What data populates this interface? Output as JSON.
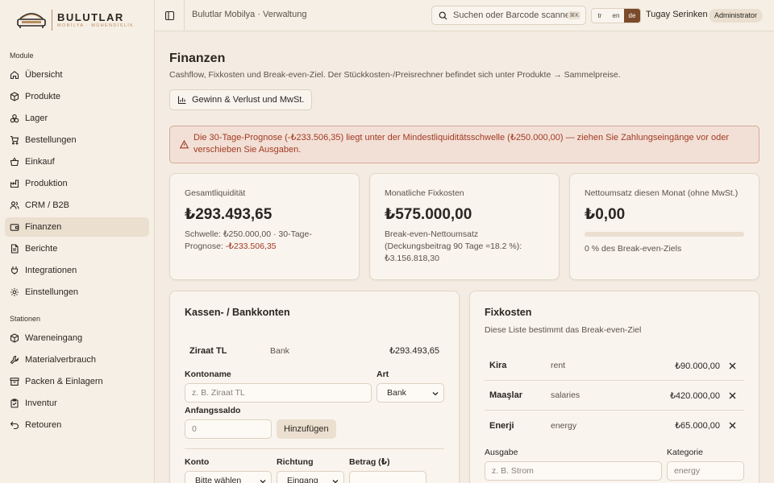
{
  "brand": {
    "name": "BULUTLAR",
    "tagline": "MOBİLYA · MÜHENDİSLİK"
  },
  "sidebar": {
    "modules_label": "Module",
    "modules": [
      {
        "label": "Übersicht",
        "icon": "home-icon",
        "active": false
      },
      {
        "label": "Produkte",
        "icon": "box-icon",
        "active": false
      },
      {
        "label": "Lager",
        "icon": "boxes-icon",
        "active": false
      },
      {
        "label": "Bestellungen",
        "icon": "cart-icon",
        "active": false
      },
      {
        "label": "Einkauf",
        "icon": "basket-icon",
        "active": false
      },
      {
        "label": "Produktion",
        "icon": "factory-icon",
        "active": false
      },
      {
        "label": "CRM / B2B",
        "icon": "users-icon",
        "active": false
      },
      {
        "label": "Finanzen",
        "icon": "wallet-icon",
        "active": true
      },
      {
        "label": "Berichte",
        "icon": "file-icon",
        "active": false
      },
      {
        "label": "Integrationen",
        "icon": "plug-icon",
        "active": false
      },
      {
        "label": "Einstellungen",
        "icon": "gear-icon",
        "active": false
      }
    ],
    "stations_label": "Stationen",
    "stations": [
      {
        "label": "Wareneingang",
        "icon": "package-in-icon"
      },
      {
        "label": "Materialverbrauch",
        "icon": "wrench-icon"
      },
      {
        "label": "Packen & Einlagern",
        "icon": "archive-icon"
      },
      {
        "label": "Inventur",
        "icon": "clipboard-icon"
      },
      {
        "label": "Retouren",
        "icon": "return-icon"
      }
    ]
  },
  "topbar": {
    "breadcrumb": "Bulutlar Mobilya · Verwaltung",
    "search_placeholder": "Suchen oder Barcode scannen",
    "search_shortcut": "⌘K",
    "languages": [
      "tr",
      "en",
      "de"
    ],
    "active_language": "de",
    "user_name": "Tugay Serinken",
    "user_role": "Administrator"
  },
  "page": {
    "title": "Finanzen",
    "subtitle": "Cashflow, Fixkosten und Break-even-Ziel. Der Stückkosten-/Preisrechner befindet sich unter Produkte → Sammelpreise.",
    "pl_button": "Gewinn & Verlust und MwSt.",
    "alert": "Die 30-Tage-Prognose (-₺233.506,35) liegt unter der Mindestliquiditätsschwelle (₺250.000,00) — ziehen Sie Zahlungseingänge vor oder verschieben Sie Ausgaben."
  },
  "stats": {
    "liquidity": {
      "label": "Gesamtliquidität",
      "value": "₺293.493,65",
      "note_prefix": "Schwelle: ₺250.000,00 · 30-Tage-Prognose: ",
      "note_negative": "-₺233.506,35"
    },
    "fixed": {
      "label": "Monatliche Fixkosten",
      "value": "₺575.000,00",
      "note": "Break-even-Nettoumsatz (Deckungsbeitrag 90 Tage ≈18.2 %): ₺3.156.818,30"
    },
    "revenue": {
      "label": "Nettoumsatz diesen Monat (ohne MwSt.)",
      "value": "₺0,00",
      "progress_percent": 0,
      "note": "0 % des Break-even-Ziels"
    }
  },
  "accounts": {
    "title": "Kassen- / Bankkonten",
    "rows": [
      {
        "name": "Ziraat TL",
        "type": "Bank",
        "balance": "₺293.493,65"
      }
    ],
    "form": {
      "name_label": "Kontoname",
      "name_placeholder": "z. B. Ziraat TL",
      "type_label": "Art",
      "type_value": "Bank",
      "opening_label": "Anfangssaldo",
      "opening_placeholder": "0",
      "add_button": "Hinzufügen"
    },
    "tx_form": {
      "account_label": "Konto",
      "account_value": "Bitte wählen",
      "direction_label": "Richtung",
      "direction_value": "Eingang",
      "amount_label": "Betrag (₺)"
    }
  },
  "fixed_costs": {
    "title": "Fixkosten",
    "hint": "Diese Liste bestimmt das Break-even-Ziel",
    "rows": [
      {
        "name": "Kira",
        "category": "rent",
        "amount": "₺90.000,00"
      },
      {
        "name": "Maaşlar",
        "category": "salaries",
        "amount": "₺420.000,00"
      },
      {
        "name": "Enerji",
        "category": "energy",
        "amount": "₺65.000,00"
      }
    ],
    "form": {
      "expense_label": "Ausgabe",
      "expense_placeholder": "z. B. Strom",
      "category_label": "Kategorie",
      "category_placeholder": "energy"
    }
  },
  "colors": {
    "accent": "#7a4a2a",
    "danger": "#a23a24",
    "background": "#f4ece2",
    "card": "#f9f4ee"
  }
}
